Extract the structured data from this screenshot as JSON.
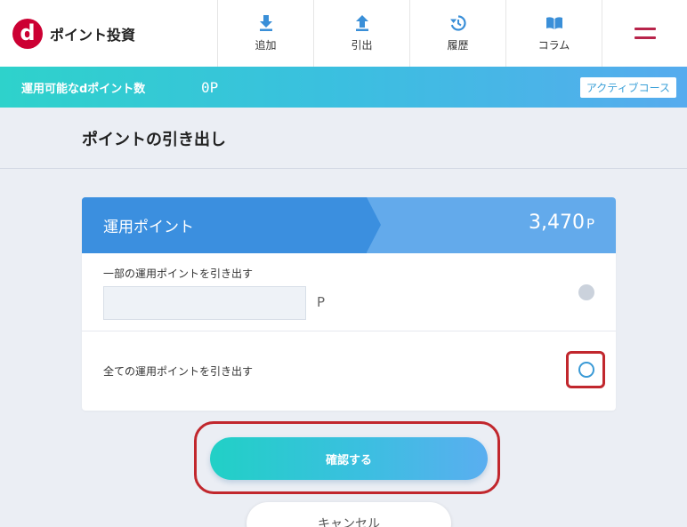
{
  "header": {
    "logo_letter": "d",
    "logo_text": "ポイント投資",
    "nav": [
      {
        "label": "追加",
        "icon": "download-arrow-icon"
      },
      {
        "label": "引出",
        "icon": "upload-arrow-icon"
      },
      {
        "label": "履歴",
        "icon": "history-icon"
      },
      {
        "label": "コラム",
        "icon": "book-icon"
      }
    ],
    "menu_icon": "hamburger-menu-icon"
  },
  "points_bar": {
    "label": "運用可能なdポイント数",
    "value": "0P",
    "course": "アクティブコース"
  },
  "page_title": "ポイントの引き出し",
  "card": {
    "title": "運用ポイント",
    "value": "3,470",
    "unit": "P",
    "option_partial": {
      "label": "一部の運用ポイントを引き出す",
      "input_value": "",
      "unit": "P"
    },
    "option_all": {
      "label": "全ての運用ポイントを引き出す"
    }
  },
  "buttons": {
    "confirm": "確認する",
    "cancel": "キャンセル"
  },
  "colors": {
    "brand_red": "#cc0033",
    "accent_blue": "#3b8fdf",
    "highlight_red": "#c1272d"
  }
}
